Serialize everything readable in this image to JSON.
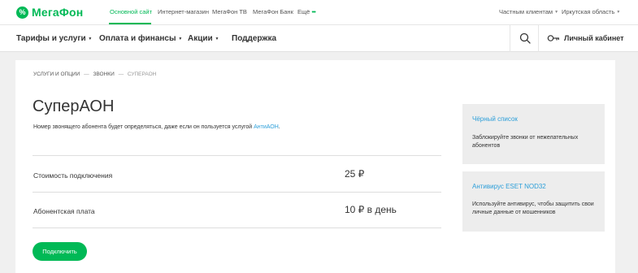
{
  "colors": {
    "brand": "#00b956",
    "link": "#2d9fd9"
  },
  "topbar": {
    "logo_text": "МегаФон",
    "links": [
      {
        "label": "Основной сайт",
        "active": true
      },
      {
        "label": "Интернет-магазин"
      },
      {
        "label": "МегаФон ТВ"
      },
      {
        "label": "МегаФон Банк"
      },
      {
        "label": "Ещё"
      }
    ],
    "segment": "Частным клиентам",
    "region": "Иркутская область"
  },
  "nav": {
    "items": [
      "Тарифы и услуги",
      "Оплата и финансы",
      "Акции",
      "Поддержка"
    ],
    "cabinet_label": "Личный кабинет"
  },
  "breadcrumb": {
    "items": [
      "Услуги и опции",
      "Звонки"
    ],
    "current": "СуперАОН",
    "separator": "—"
  },
  "page": {
    "title": "СуперАОН",
    "description_prefix": "Номер звонящего абонента будет определяться, даже если он пользуется услугой ",
    "description_link": "АнтиАОН",
    "description_suffix": "."
  },
  "pricing": [
    {
      "label": "Стоимость подключения",
      "value": "25 ₽"
    },
    {
      "label": "Абонентская плата",
      "value": "10 ₽ в день"
    }
  ],
  "connect_button": "Подключить",
  "related": [
    {
      "title": "Чёрный список",
      "text": "Заблокируйте звонки от нежелательных абонентов"
    },
    {
      "title": "Антивирус ESET NOD32",
      "text": "Используйте антивирус, чтобы защитить свои личные данные от мошенников"
    }
  ]
}
